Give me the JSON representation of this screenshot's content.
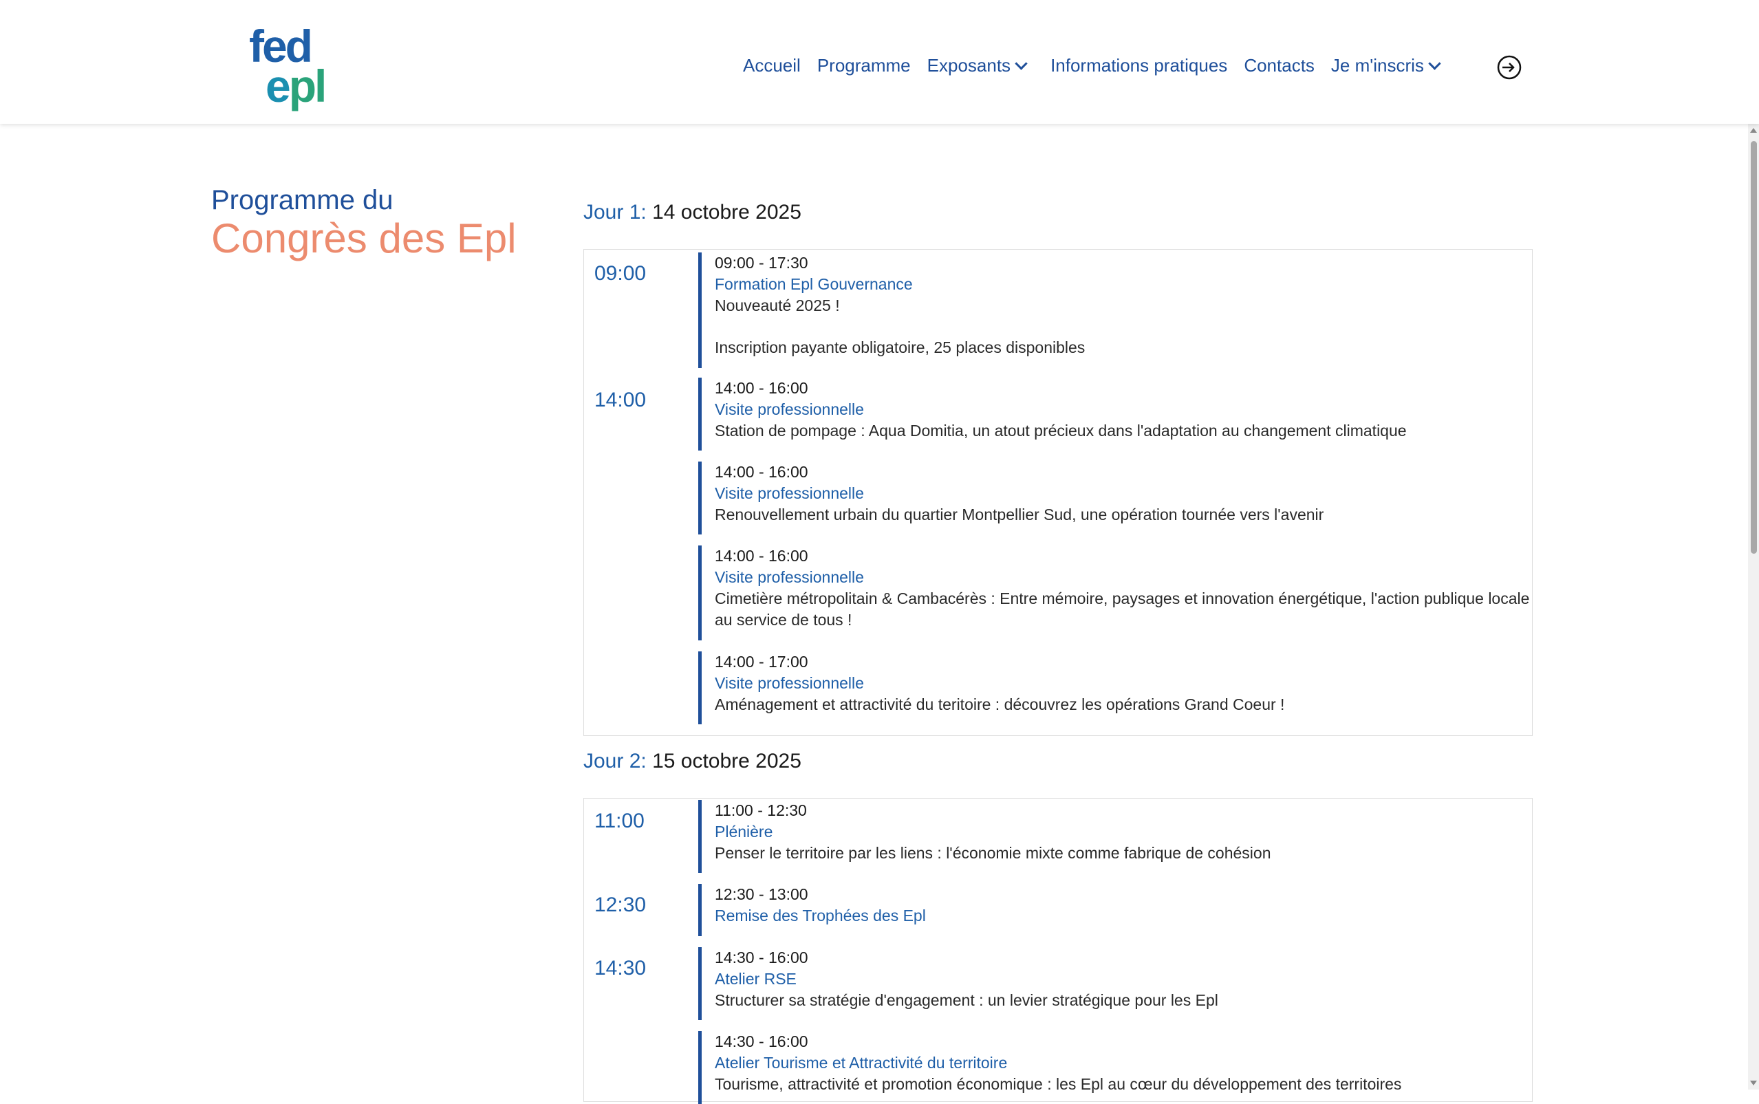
{
  "logo": {
    "line1": "fed",
    "line2_e": "e",
    "line2_rest": "pl"
  },
  "nav": {
    "items": [
      {
        "label": "Accueil"
      },
      {
        "label": "Programme"
      },
      {
        "label": "Exposants"
      },
      {
        "label": "Informations pratiques"
      },
      {
        "label": "Contacts"
      },
      {
        "label": "Je m'inscris"
      }
    ]
  },
  "page_title": {
    "line1": "Programme du",
    "line2": "Congrès des Epl"
  },
  "days": [
    {
      "label": "Jour 1:",
      "date": "14 octobre 2025",
      "slots": [
        {
          "time": "09:00"
        },
        {
          "time": "14:00"
        }
      ],
      "events": [
        {
          "time": "09:00 - 17:30",
          "title": "Formation Epl Gouvernance",
          "desc": "Nouveauté 2025 !",
          "desc2": "Inscription payante obligatoire, 25 places disponibles"
        },
        {
          "time": "14:00 - 16:00",
          "title": "Visite professionnelle",
          "desc": "Station de pompage : Aqua Domitia, un atout précieux dans l'adaptation au changement climatique"
        },
        {
          "time": "14:00 - 16:00",
          "title": "Visite professionnelle",
          "desc": "Renouvellement urbain du quartier Montpellier Sud, une opération tournée vers l'avenir"
        },
        {
          "time": "14:00 - 16:00",
          "title": "Visite professionnelle",
          "desc": "Cimetière métropolitain & Cambacérès : Entre mémoire, paysages et innovation énergétique, l'action publique locale au service de tous !"
        },
        {
          "time": "14:00 - 17:00",
          "title": "Visite professionnelle",
          "desc": "Aménagement et attractivité du teritoire : découvrez les opérations Grand Coeur !"
        }
      ]
    },
    {
      "label": "Jour 2:",
      "date": "15 octobre 2025",
      "slots": [
        {
          "time": "11:00"
        },
        {
          "time": "12:30"
        },
        {
          "time": "14:30"
        }
      ],
      "events": [
        {
          "time": "11:00 - 12:30",
          "title": "Plénière",
          "desc": "Penser le territoire par les liens : l'économie mixte comme fabrique de cohésion"
        },
        {
          "time": "12:30 - 13:00",
          "title": "Remise des Trophées des Epl",
          "desc": ""
        },
        {
          "time": "14:30 - 16:00",
          "title": "Atelier RSE",
          "desc": "Structurer sa stratégie d'engagement : un levier stratégique pour les Epl"
        },
        {
          "time": "14:30 - 16:00",
          "title": "Atelier Tourisme et Attractivité du territoire",
          "desc": "Tourisme, attractivité et promotion économique : les Epl au cœur du développement des territoires"
        }
      ]
    }
  ]
}
